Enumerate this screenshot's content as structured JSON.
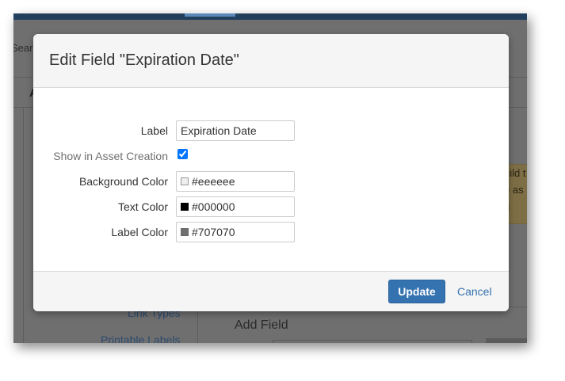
{
  "background": {
    "search_fragment": "Sear",
    "header_letter": "A",
    "callout_lines": [
      "uild t",
      "e as",
      "u"
    ],
    "sidebar_links": [
      "Link Types",
      "Printable Labels"
    ],
    "add_field_heading": "Add Field"
  },
  "modal": {
    "title": "Edit Field \"Expiration Date\"",
    "fields": {
      "label": {
        "label": "Label",
        "value": "Expiration Date"
      },
      "show_in_asset_creation": {
        "label": "Show in Asset Creation",
        "checked": true
      },
      "background_color": {
        "label": "Background Color",
        "value": "#eeeeee",
        "swatch": "#eeeeee"
      },
      "text_color": {
        "label": "Text Color",
        "value": "#000000",
        "swatch": "#000000"
      },
      "label_color": {
        "label": "Label Color",
        "value": "#707070",
        "swatch": "#707070"
      }
    },
    "footer": {
      "update_label": "Update",
      "cancel_label": "Cancel"
    }
  },
  "colors": {
    "primary": "#3572b0",
    "link": "#3572b0",
    "header_bg": "#f5f5f5"
  }
}
